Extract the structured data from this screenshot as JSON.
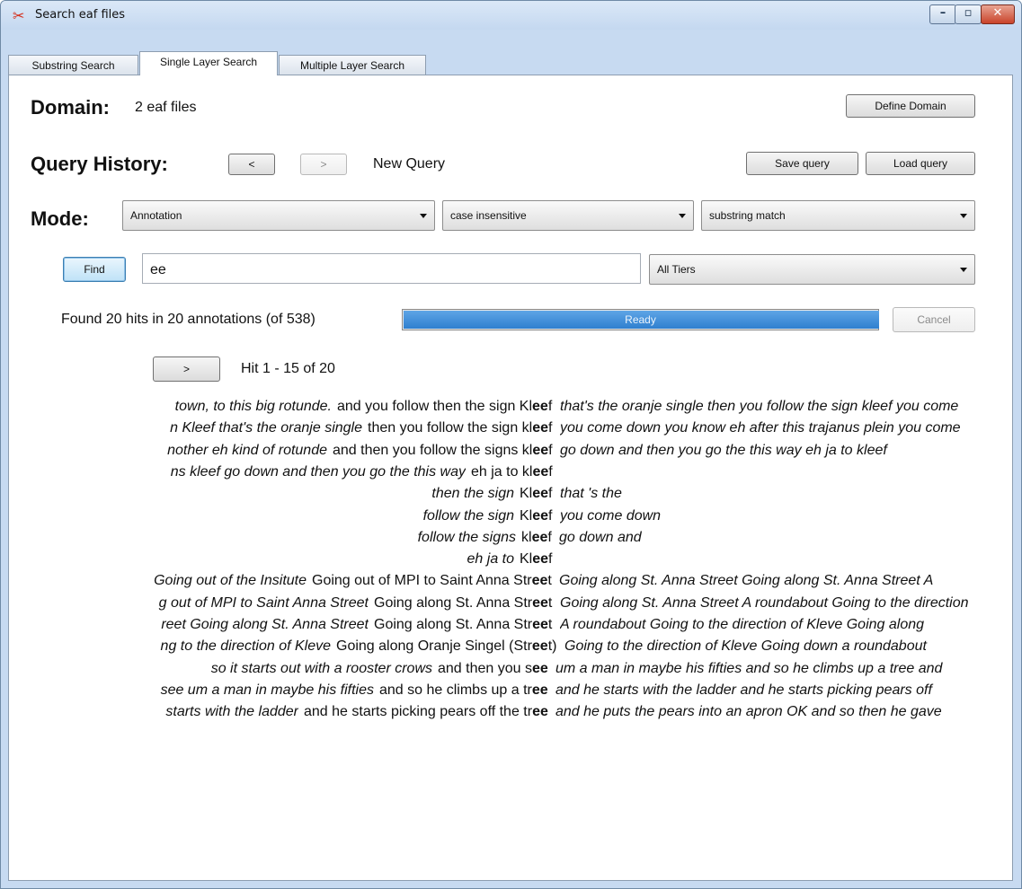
{
  "window": {
    "title": "Search eaf files",
    "icon": "elan-logo-icon",
    "controls": {
      "minimize": "minimize-icon",
      "maximize": "maximize-icon",
      "close": "close-icon"
    }
  },
  "tabs": [
    {
      "label": "Substring Search",
      "active": false
    },
    {
      "label": "Single Layer Search",
      "active": true
    },
    {
      "label": "Multiple Layer Search",
      "active": false
    }
  ],
  "domain": {
    "label": "Domain:",
    "value": "2 eaf files",
    "define_button": "Define Domain"
  },
  "history": {
    "label": "Query History:",
    "prev": "<",
    "next": ">",
    "status": "New Query",
    "save": "Save query",
    "load": "Load query"
  },
  "mode": {
    "label": "Mode:",
    "type": "Annotation",
    "case": "case insensitive",
    "match": "substring match"
  },
  "search": {
    "find": "Find",
    "query": "ee",
    "tiers": "All Tiers"
  },
  "status": {
    "summary": "Found 20 hits in 20 annotations (of 538)",
    "progress_text": "Ready",
    "progress": 1.0,
    "cancel": "Cancel"
  },
  "paging": {
    "next": ">",
    "range": "Hit 1 - 15 of 20"
  },
  "results": [
    {
      "left": "town, to this big rotunde.",
      "pre": "and you follow then the sign Kl",
      "match": "ee",
      "post": "f",
      "right": "that's the oranje single  then you follow the sign kleef  you come"
    },
    {
      "left": "n Kleef  that's the oranje single",
      "pre": "then you follow the sign kl",
      "match": "ee",
      "post": "f",
      "right": "you come down  you know eh after this trajanus plein  you come"
    },
    {
      "left": "nother eh  kind of rotunde",
      "pre": "and then you follow the signs kl",
      "match": "ee",
      "post": "f",
      "right": "go down  and then you go the this way  eh ja to kleef"
    },
    {
      "left": "ns kleef  go down  and then you go the this way",
      "pre": "eh ja to kl",
      "match": "ee",
      "post": "f",
      "right": ""
    },
    {
      "left": "then  the  sign",
      "pre": "Kl",
      "match": "ee",
      "post": "f",
      "right": "that  's  the"
    },
    {
      "left": "follow  the  sign",
      "pre": "Kl",
      "match": "ee",
      "post": "f",
      "right": "you  come  down"
    },
    {
      "left": "follow  the  signs",
      "pre": "kl",
      "match": "ee",
      "post": "f",
      "right": "go  down  and"
    },
    {
      "left": "eh  ja  to",
      "pre": "Kl",
      "match": "ee",
      "post": "f",
      "right": ""
    },
    {
      "left": "Going out of the Insitute",
      "pre": "Going out of MPI to Saint Anna Str",
      "match": "ee",
      "post": "t",
      "right": "Going along St. Anna Street  Going along St. Anna Street  A"
    },
    {
      "left": "g out of MPI to Saint Anna Street",
      "pre": "Going along St. Anna Str",
      "match": "ee",
      "post": "t",
      "right": "Going along St. Anna Street  A roundabout  Going to the direction"
    },
    {
      "left": "reet  Going along St. Anna Street",
      "pre": "Going along St. Anna Str",
      "match": "ee",
      "post": "t",
      "right": "A roundabout  Going to the direction of Kleve  Going along"
    },
    {
      "left": "ng to the direction of Kleve",
      "pre": "Going along Oranje Singel (Str",
      "match": "ee",
      "post": "t)",
      "right": "Going to the direction of Kleve  Going down  a roundabout"
    },
    {
      "left": "so it starts out with a rooster crows",
      "pre": "and then you s",
      "match": "ee",
      "post": "",
      "right": "um a man in maybe his fifties  and so he climbs up a tree and"
    },
    {
      "left": "see um a man in maybe his fifties",
      "pre": "and so he climbs up a tr",
      "match": "ee",
      "post": "",
      "right": "and he starts with the ladder  and he starts picking pears off"
    },
    {
      "left": "starts with the ladder",
      "pre": "and he starts picking pears off the tr",
      "match": "ee",
      "post": "",
      "right": "and he puts the pears into an apron  OK  and so then he gave"
    }
  ]
}
